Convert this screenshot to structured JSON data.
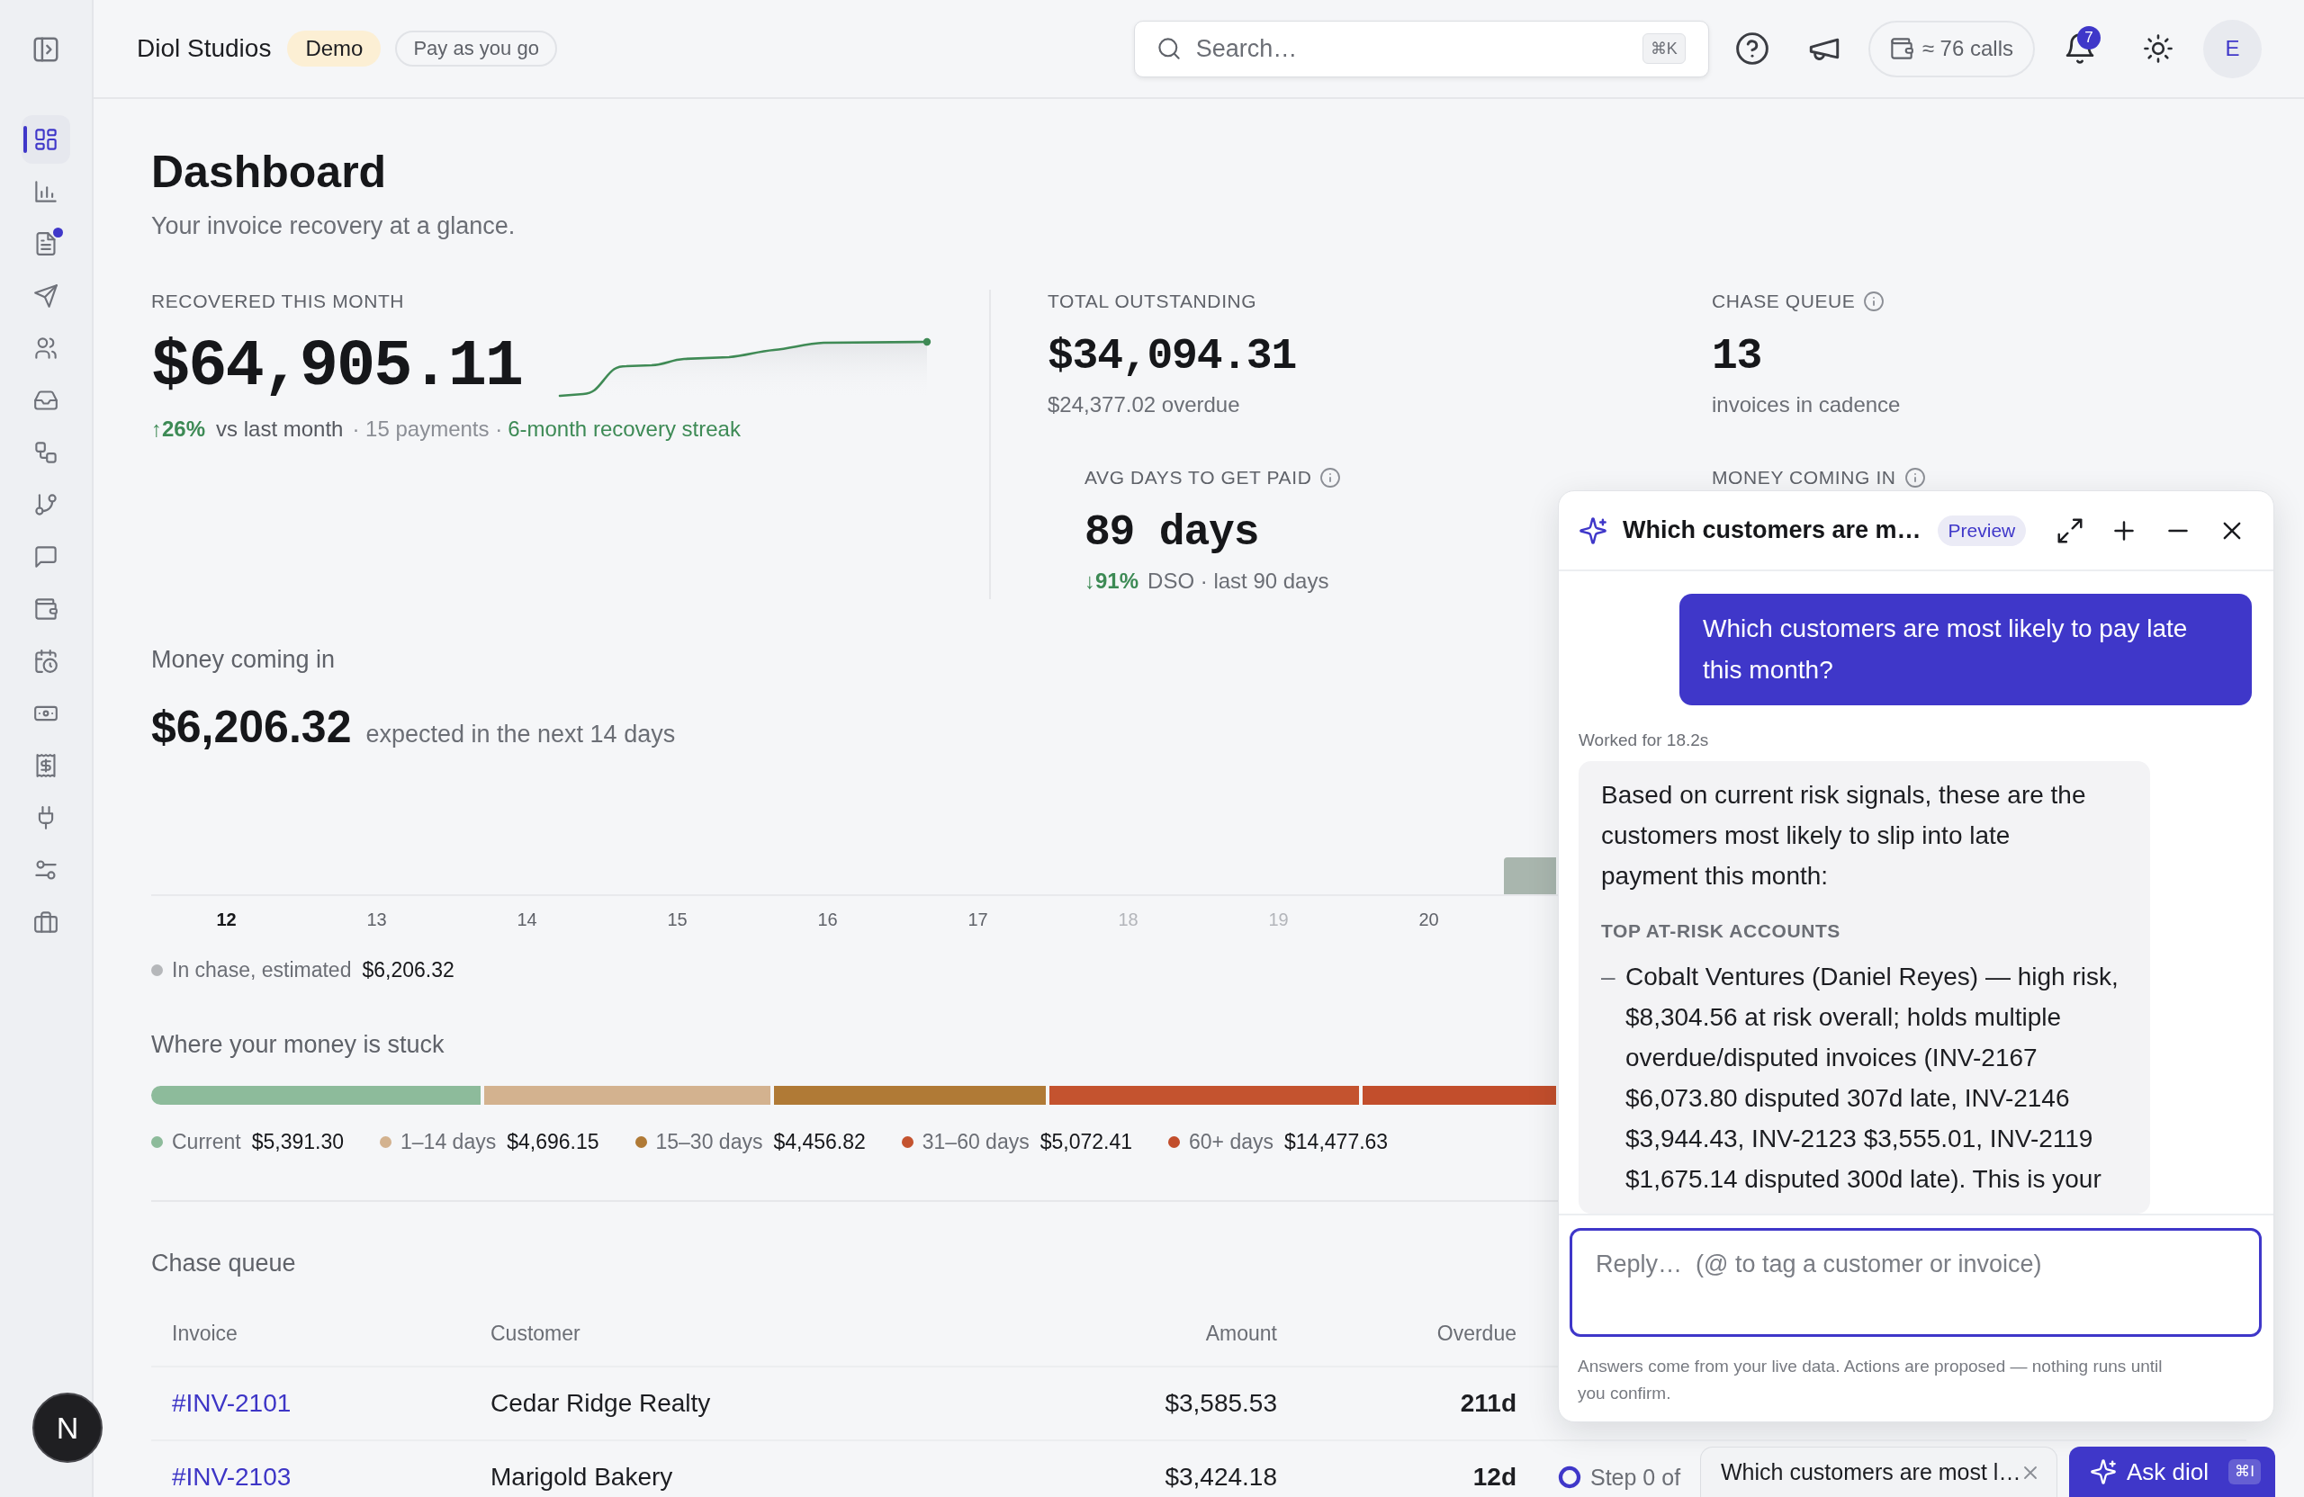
{
  "sidebar": {
    "items": [
      {
        "selected": true,
        "dot": false
      },
      {
        "selected": false,
        "dot": false
      },
      {
        "selected": false,
        "dot": true
      },
      {
        "selected": false,
        "dot": false
      },
      {
        "selected": false,
        "dot": false
      },
      {
        "selected": false,
        "dot": false
      },
      {
        "selected": false,
        "dot": false
      },
      {
        "selected": false,
        "dot": false
      },
      {
        "selected": false,
        "dot": false
      },
      {
        "selected": false,
        "dot": false
      },
      {
        "selected": false,
        "dot": false
      },
      {
        "selected": false,
        "dot": false
      },
      {
        "selected": false,
        "dot": false
      },
      {
        "selected": false,
        "dot": false
      },
      {
        "selected": false,
        "dot": false
      },
      {
        "selected": false,
        "dot": false
      }
    ]
  },
  "header": {
    "workspace": "Diol Studios",
    "plan_badge": "Demo",
    "billing_pill": "Pay as you go",
    "search": {
      "placeholder": "Search…",
      "shortcut": "⌘K"
    },
    "usage": "≈ 76 calls",
    "notification_count": "7",
    "avatar": "E"
  },
  "page": {
    "title": "Dashboard",
    "subtitle": "Your invoice recovery at a glance."
  },
  "recovered": {
    "label": "RECOVERED THIS MONTH",
    "value": "$64,905.11",
    "delta": "↑26%",
    "comparison": "vs last month",
    "payments": "· 15 payments ·",
    "streak": "6-month recovery streak"
  },
  "stats": [
    {
      "label": "TOTAL OUTSTANDING",
      "info": false,
      "value": "$34,094.31",
      "caption": "$24,377.02 overdue"
    },
    {
      "label": "CHASE QUEUE",
      "info": true,
      "value": "13",
      "caption": "invoices in cadence"
    },
    {
      "label": "AVG DAYS TO GET PAID",
      "info": true,
      "value": "89 days",
      "delta": "↓91%",
      "caption": "DSO · last 90 days"
    },
    {
      "label": "MONEY COMING IN",
      "info": true
    }
  ],
  "money_coming_in": {
    "title": "Money coming in",
    "amount": "$6,206.32",
    "caption": "expected in the next 14 days",
    "days": [
      {
        "label": "12",
        "kind": "today"
      },
      {
        "label": "13",
        "kind": "weekday"
      },
      {
        "label": "14",
        "kind": "weekday"
      },
      {
        "label": "15",
        "kind": "weekday"
      },
      {
        "label": "16",
        "kind": "weekday"
      },
      {
        "label": "17",
        "kind": "weekday"
      },
      {
        "label": "18",
        "kind": "weekend"
      },
      {
        "label": "19",
        "kind": "weekend"
      },
      {
        "label": "20",
        "kind": "weekday"
      }
    ],
    "legend": [
      {
        "label": "In chase, estimated",
        "amount": "$6,206.32",
        "color": "#b5b7ba"
      }
    ]
  },
  "money_stuck": {
    "title": "Where your money is stuck",
    "buckets": [
      {
        "label": "Current",
        "amount": "$5,391.30",
        "color": "#8dbb9b"
      },
      {
        "label": "1–14 days",
        "amount": "$4,696.15",
        "color": "#d3b28f"
      },
      {
        "label": "15–30 days",
        "amount": "$4,456.82",
        "color": "#b07a36"
      },
      {
        "label": "31–60 days",
        "amount": "$5,072.41",
        "color": "#c4532f"
      },
      {
        "label": "60+ days",
        "amount": "$14,477.63",
        "color": "#c24e2c"
      }
    ]
  },
  "chase_queue": {
    "title": "Chase queue",
    "columns": [
      "Invoice",
      "Customer",
      "Amount",
      "Overdue"
    ],
    "rows": [
      {
        "invoice": "#INV-2101",
        "customer": "Cedar Ridge Realty",
        "amount": "$3,585.53",
        "overdue": "211d"
      },
      {
        "invoice": "#INV-2103",
        "customer": "Marigold Bakery",
        "amount": "$3,424.18",
        "overdue": "12d",
        "status": "Step 0 of"
      }
    ]
  },
  "assistant": {
    "title": "Which customers are m…",
    "badge": "Preview",
    "messages": [
      {
        "kind": "user",
        "text": "Which customers are most likely to pay late this month?"
      },
      {
        "kind": "status",
        "text": "Worked for 18.2s"
      },
      {
        "kind": "assistant",
        "paragraph": "Based on current risk signals, these are the customers most likely to slip into late payment this month:",
        "heading": "TOP AT-RISK ACCOUNTS",
        "items": [
          {
            "marker": "–",
            "text": "Cobalt Ventures (Daniel Reyes) — high risk, $8,304.56 at risk overall; holds multiple overdue/disputed invoices (INV-2167 $6,073.80 disputed 307d late, INV-2146 $3,944.43, INV-2123 $3,555.01, INV-2119 $1,675.14 disputed 300d late). This is your"
          }
        ]
      }
    ],
    "reply": {
      "placeholder": "Reply…  (@ to tag a customer or invoice)"
    },
    "footnote": "Answers come from your live data. Actions are proposed — nothing runs until you confirm."
  },
  "chat_dock": {
    "tabs": [
      {
        "label": "Which customers are most l…"
      }
    ],
    "ask_button": {
      "label": "Ask diol",
      "shortcut": "⌘I"
    }
  },
  "dev_badge": "N"
}
